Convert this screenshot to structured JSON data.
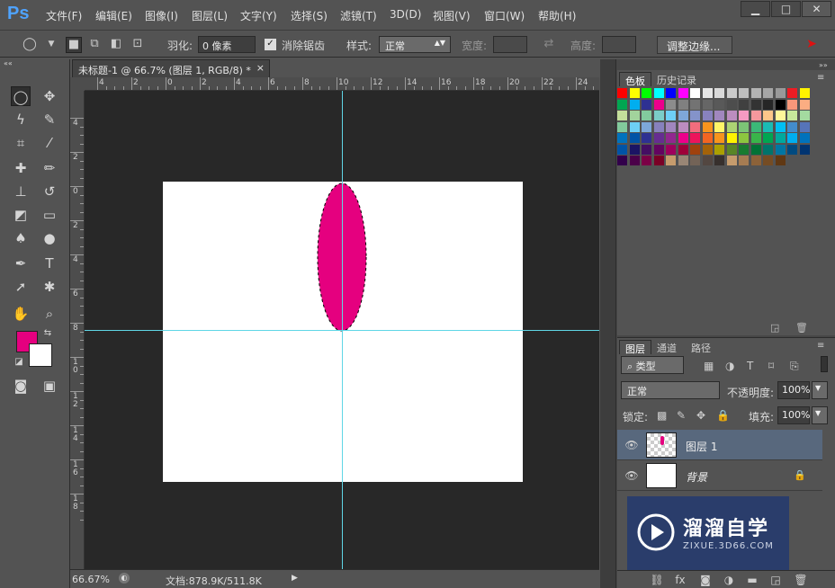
{
  "app": {
    "logo": "Ps"
  },
  "menu": [
    "文件(F)",
    "编辑(E)",
    "图像(I)",
    "图层(L)",
    "文字(Y)",
    "选择(S)",
    "滤镜(T)",
    "3D(D)",
    "视图(V)",
    "窗口(W)",
    "帮助(H)"
  ],
  "window_controls": {
    "minimize": "▁",
    "maximize": "□",
    "close": "✕"
  },
  "options": {
    "feather_label": "羽化:",
    "feather_value": "0 像素",
    "antialias_label": "消除锯齿",
    "style_label": "样式:",
    "style_value": "正常",
    "width_label": "宽度:",
    "height_label": "高度:",
    "refine_edge": "调整边缘..."
  },
  "document_tab": {
    "title": "未标题-1 @ 66.7% (图层 1, RGB/8) *",
    "close": "×"
  },
  "rulers": {
    "top": [
      "4",
      "2",
      "0",
      "2",
      "4",
      "6",
      "8",
      "10",
      "12",
      "14",
      "16",
      "18",
      "20",
      "22",
      "24"
    ],
    "left": [
      "4",
      "2",
      "0",
      "2",
      "4",
      "6",
      "8",
      "10",
      "12",
      "14",
      "16",
      "18"
    ]
  },
  "colors": {
    "foreground": "#e5007f",
    "background": "#ffffff",
    "ellipse": "#e5007f",
    "guide": "#5fd6e6"
  },
  "status": {
    "zoom": "66.67%",
    "doc_info": "文档:878.9K/511.8K"
  },
  "swatch_panel": {
    "tabs": [
      "色板",
      "历史记录"
    ]
  },
  "swatches": [
    [
      "#ff0000",
      "#ffff00",
      "#00ff00",
      "#00ffff",
      "#0000ff",
      "#ff00ff",
      "#ffffff",
      "#e6e6e6",
      "#d9d9d9",
      "#cccccc",
      "#bfbfbf",
      "#b3b3b3",
      "#a6a6a6",
      "#999999",
      "#ed1c24",
      "#fff200"
    ],
    [
      "#00a651",
      "#00aeef",
      "#2e3192",
      "#ec008c",
      "#8c8c8c",
      "#808080",
      "#737373",
      "#666666",
      "#595959",
      "#4d4d4d",
      "#404040",
      "#333333",
      "#262626",
      "#000000",
      "#f7977a",
      "#fbad82"
    ],
    [
      "#c4df9b",
      "#a2d39c",
      "#82ca9d",
      "#7bcdc8",
      "#6ecff6",
      "#7ea7d8",
      "#8493ca",
      "#8882be",
      "#a187be",
      "#bc8dbf",
      "#f49ac2",
      "#f6989d",
      "#fdc68a",
      "#fff79a",
      "#c7e89b",
      "#a4dba0"
    ],
    [
      "#82ca9c",
      "#6dcff6",
      "#7da7d9",
      "#8781bd",
      "#a186be",
      "#bd8cbf",
      "#f26d7d",
      "#f7941d",
      "#fff568",
      "#acd373",
      "#7cc576",
      "#3bb878",
      "#1abbb4",
      "#00bff3",
      "#438ccb",
      "#5674b9"
    ],
    [
      "#0072bc",
      "#0054a6",
      "#2e3192",
      "#662d91",
      "#92278f",
      "#ec008b",
      "#ed145b",
      "#f26522",
      "#f7941d",
      "#fff200",
      "#8dc63f",
      "#39b54a",
      "#00a651",
      "#00a99d",
      "#00aeef",
      "#0072bc"
    ],
    [
      "#0054a6",
      "#1b1464",
      "#440e62",
      "#630460",
      "#9e005d",
      "#9e0039",
      "#a0410d",
      "#a36209",
      "#aba000",
      "#598527",
      "#197b30",
      "#007236",
      "#00746b",
      "#0076a3",
      "#004a80",
      "#003471"
    ],
    [
      "#32004b",
      "#4b0049",
      "#7b0046",
      "#7a0026",
      "#c69c6d",
      "#998675",
      "#736357",
      "#534741",
      "#37302d",
      "#c69c6d",
      "#a67c52",
      "#8c6239",
      "#754c24",
      "#603813"
    ]
  ],
  "layers_panel": {
    "tabs": [
      "图层",
      "通道",
      "路径"
    ],
    "filter_kind": "类型",
    "blend_mode": "正常",
    "opacity_label": "不透明度:",
    "opacity_value": "100%",
    "lock_label": "锁定:",
    "fill_label": "填充:",
    "fill_value": "100%",
    "layers": [
      {
        "name": "图层 1",
        "selected": true
      },
      {
        "name": "背景",
        "selected": false
      }
    ]
  },
  "watermark": {
    "title": "溜溜自学",
    "url": "ZIXUE.3D66.COM"
  }
}
